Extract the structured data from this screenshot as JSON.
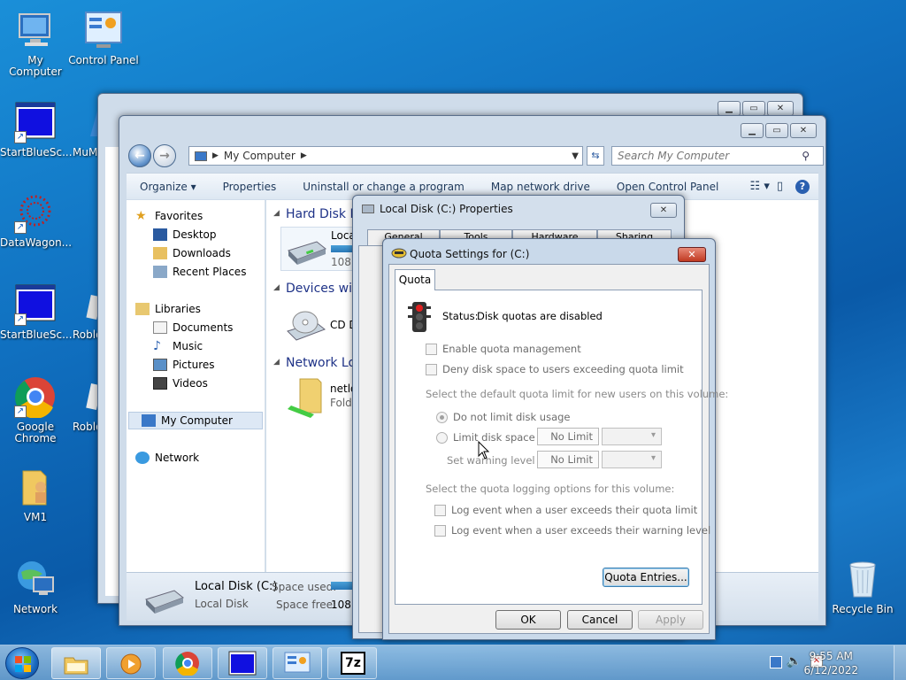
{
  "desktop": {
    "icons": [
      {
        "label": "My Computer"
      },
      {
        "label": "Control Panel"
      },
      {
        "label": "StartBlueSc..."
      },
      {
        "label": "MuM..."
      },
      {
        "label": "DataWagon..."
      },
      {
        "label": "StartBlueSc..."
      },
      {
        "label": "Roblo..."
      },
      {
        "label": "Google Chrome"
      },
      {
        "label": "Roblo..."
      },
      {
        "label": "VM1"
      },
      {
        "label": "Network"
      },
      {
        "label": "Recycle Bin"
      }
    ]
  },
  "explorer": {
    "address": "My Computer",
    "search_placeholder": "Search My Computer",
    "toolbar": {
      "organize": "Organize ▾",
      "properties": "Properties",
      "uninstall": "Uninstall or change a program",
      "map_drive": "Map network drive",
      "control_panel": "Open Control Panel"
    },
    "nav": {
      "favorites": "Favorites",
      "desktop": "Desktop",
      "downloads": "Downloads",
      "recent": "Recent Places",
      "libraries": "Libraries",
      "documents": "Documents",
      "music": "Music",
      "pictures": "Pictures",
      "videos": "Videos",
      "my_computer": "My Computer",
      "network": "Network"
    },
    "groups": {
      "hdd": "Hard Disk D",
      "devices": "Devices wit",
      "netloc": "Network Lo"
    },
    "items": {
      "local_name": "Loca",
      "local_size": "108",
      "cd_name": "CD D",
      "net_name": "netlo",
      "net_sub": "Folde"
    },
    "status": {
      "name": "Local Disk (C:)",
      "type": "Local Disk",
      "space_used_label": "Space used:",
      "space_free_label": "Space free:",
      "space_free_value": "108 G"
    }
  },
  "properties_dialog": {
    "title": "Local Disk (C:) Properties",
    "tabs": [
      "General",
      "Tools",
      "Hardware",
      "Sharing"
    ]
  },
  "quota_dialog": {
    "title": "Quota Settings for  (C:)",
    "tab": "Quota",
    "status_label": "Status:",
    "status_text": "Disk quotas are disabled",
    "enable_quota": "Enable quota management",
    "deny_space": "Deny disk space to users exceeding quota limit",
    "default_hint": "Select the default quota limit for new users on this volume:",
    "do_not_limit": "Do not limit disk usage",
    "limit_to": "Limit disk space to",
    "limit_value": "No Limit",
    "warning_label": "Set warning level to",
    "warning_value": "No Limit",
    "logging_hint": "Select the quota logging options for this volume:",
    "log_quota": "Log event when a user exceeds their quota limit",
    "log_warning": "Log event when a user exceeds their warning level",
    "entries_button": "Quota Entries...",
    "ok": "OK",
    "cancel": "Cancel",
    "apply": "Apply"
  },
  "taskbar": {
    "time": "9:55 AM",
    "date": "6/12/2022"
  }
}
